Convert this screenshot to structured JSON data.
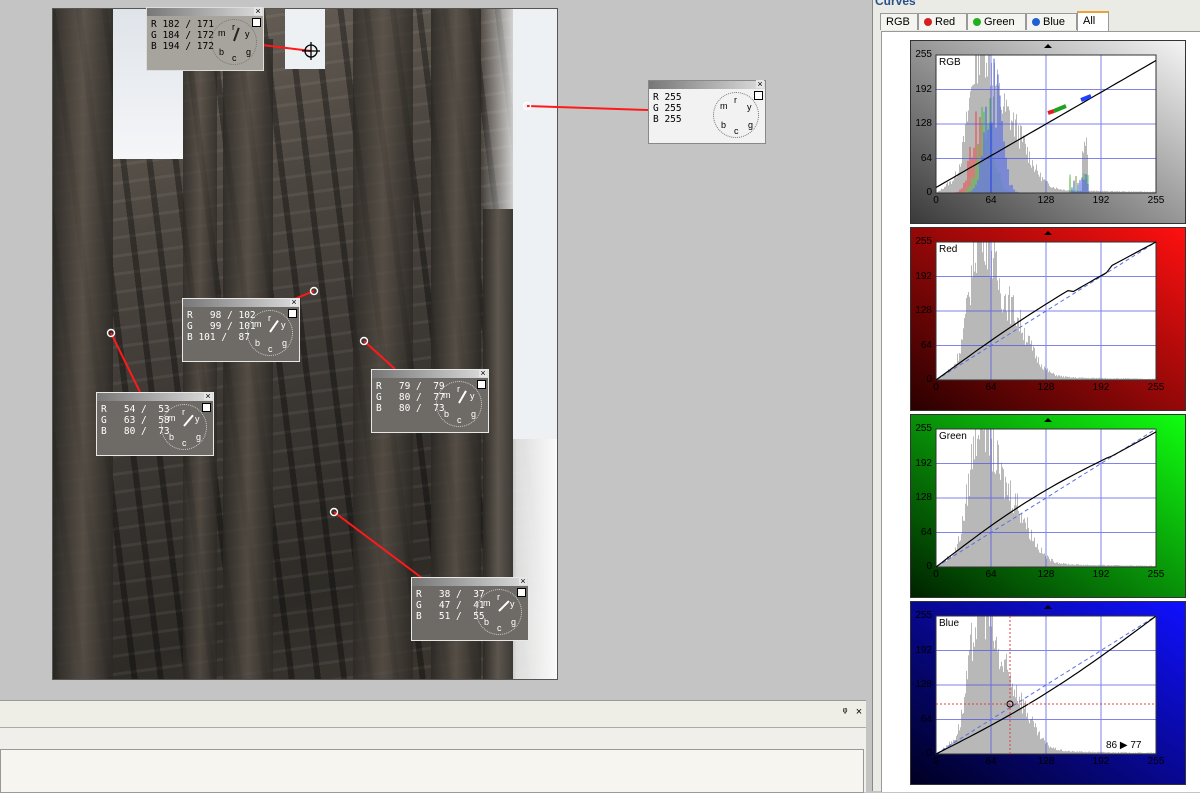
{
  "canvas": {
    "readouts": [
      {
        "id": "top",
        "rows": [
          "R 182 / 171",
          "G 184 / 172",
          "B 194 / 172"
        ],
        "dial": [
          "m",
          "r",
          "y",
          "b",
          "c",
          "g"
        ]
      },
      {
        "id": "white",
        "rows": [
          "R 255",
          "G 255",
          "B 255"
        ],
        "dial": [
          "m",
          "r",
          "y",
          "b",
          "c",
          "g"
        ]
      },
      {
        "id": "mid",
        "rows": [
          "R   98 / 102",
          "G   99 / 101",
          "B 101 /  87"
        ],
        "dial": [
          "m",
          "r",
          "y",
          "b",
          "c",
          "g"
        ]
      },
      {
        "id": "left",
        "rows": [
          "R   54 /  53",
          "G   63 /  58",
          "B   80 /  73"
        ],
        "dial": [
          "m",
          "r",
          "y",
          "b",
          "c",
          "g"
        ]
      },
      {
        "id": "right",
        "rows": [
          "R   79 /  79",
          "G   80 /  77",
          "B   80 /  73"
        ],
        "dial": [
          "m",
          "r",
          "y",
          "b",
          "c",
          "g"
        ]
      },
      {
        "id": "bottom",
        "rows": [
          "R   38 /  37",
          "G   47 /  41",
          "B   51 /  55"
        ],
        "dial": [
          "m",
          "r",
          "y",
          "b",
          "c",
          "g"
        ]
      }
    ],
    "close_glyph": "×"
  },
  "bottom_panel": {
    "pin_glyph": "ᵠ",
    "close_glyph": "×"
  },
  "curves": {
    "title": "Curves",
    "tabs": [
      {
        "label": "RGB"
      },
      {
        "label": "Red",
        "color": "#d42020"
      },
      {
        "label": "Green",
        "color": "#20b020"
      },
      {
        "label": "Blue",
        "color": "#2060d0"
      },
      {
        "label": "All",
        "active": true
      }
    ],
    "axis_ticks": [
      "0",
      "64",
      "128",
      "192",
      "255"
    ],
    "graphs": [
      {
        "label": "RGB",
        "bg_from": "#3a3a3a",
        "bg_to": "#f4f4f4",
        "readout": ""
      },
      {
        "label": "Red",
        "bg_from": "#2a0000",
        "bg_to": "#ff1010",
        "readout": ""
      },
      {
        "label": "Green",
        "bg_from": "#002200",
        "bg_to": "#10ff10",
        "readout": ""
      },
      {
        "label": "Blue",
        "bg_from": "#000022",
        "bg_to": "#1010ff",
        "readout": "86 ▶ 77"
      }
    ]
  }
}
